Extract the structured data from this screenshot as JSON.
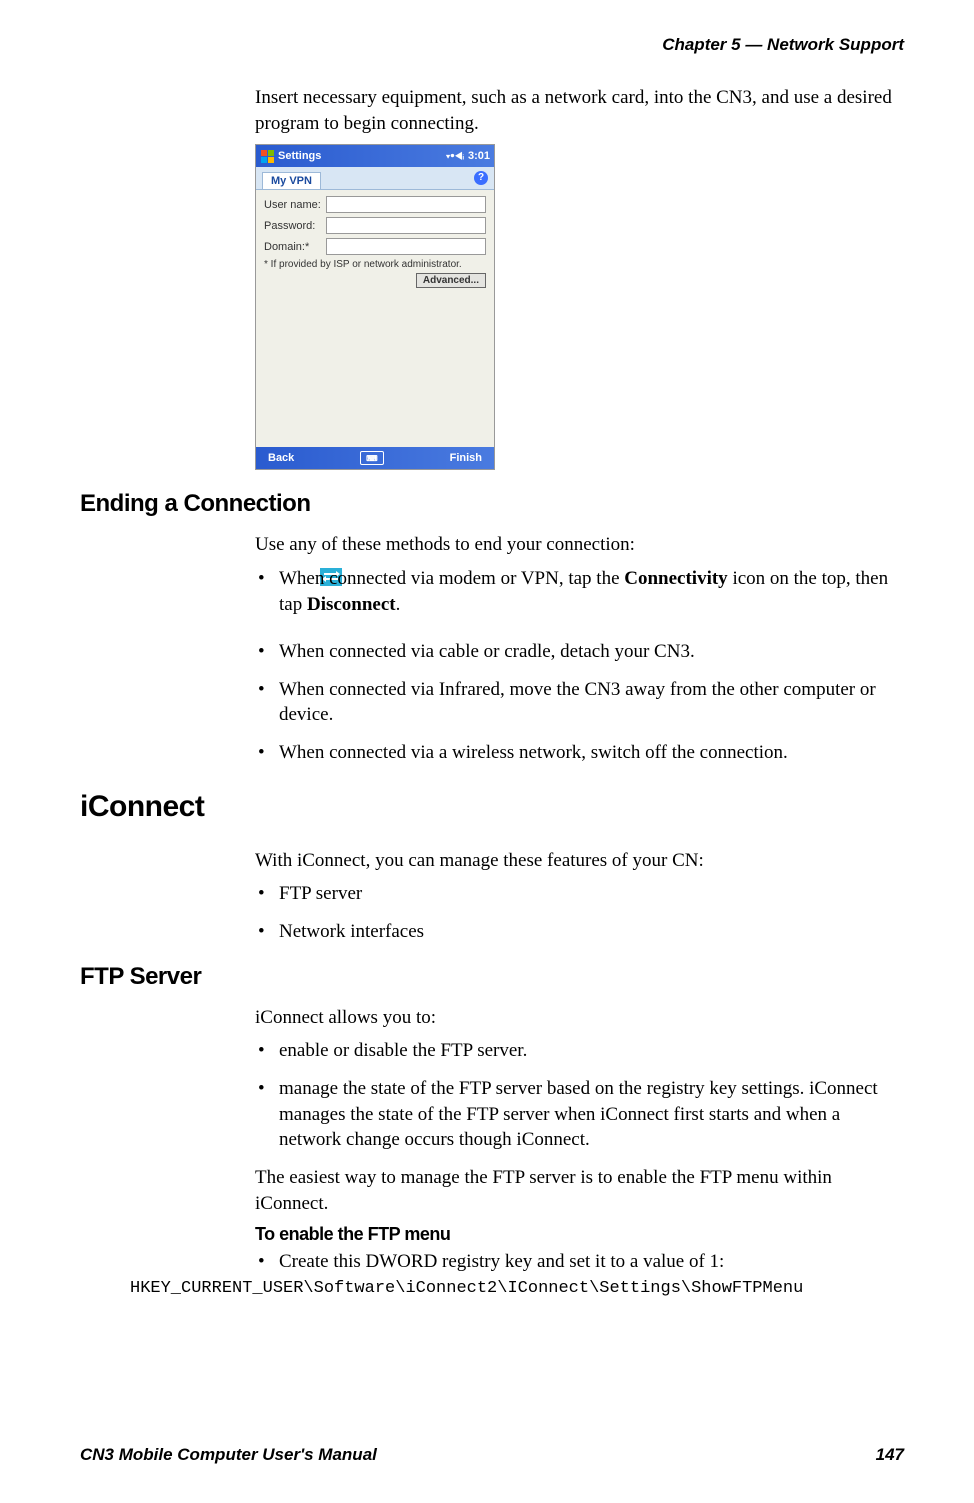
{
  "header": {
    "chapter": "Chapter 5 —  Network Support"
  },
  "intro_text": "Insert necessary equipment, such as a network card, into the CN3, and use a desired program to begin connecting.",
  "screenshot": {
    "titlebar": {
      "title": "Settings",
      "time": "3:01"
    },
    "tab": "My VPN",
    "fields": {
      "username_label": "User name:",
      "password_label": "Password:",
      "domain_label": "Domain:*"
    },
    "note": "* If provided by ISP or network administrator.",
    "advanced_btn": "Advanced...",
    "back_btn": "Back",
    "finish_btn": "Finish"
  },
  "ending": {
    "heading": "Ending a Connection",
    "intro": "Use any of these methods to end your connection:",
    "item1_pre": "When connected via modem or VPN, tap the ",
    "item1_bold1": "Connectivity",
    "item1_mid": " icon on the top, then tap ",
    "item1_bold2": "Disconnect",
    "item1_post": ".",
    "item2": "When connected via cable or cradle, detach your CN3.",
    "item3": "When connected via Infrared, move the CN3 away from the other computer or device.",
    "item4": "When connected via a wireless network, switch off the connection."
  },
  "iconnect": {
    "heading": "iConnect",
    "intro": "With iConnect, you can manage these features of your CN:",
    "item1": "FTP server",
    "item2": "Network interfaces"
  },
  "ftp": {
    "heading": "FTP Server",
    "intro": "iConnect allows you to:",
    "item1": "enable or disable the FTP server.",
    "item2": "manage the state of the FTP server based on the registry key settings. iConnect manages the state of the FTP server when iConnect first starts and when a network change occurs though iConnect.",
    "outro": "The easiest way to manage the FTP server is to enable the FTP menu within iConnect.",
    "subheading": "To enable the FTP menu",
    "sub_item": "Create this DWORD registry key and set it to a value of 1:",
    "regkey": "HKEY_CURRENT_USER\\Software\\iConnect2\\IConnect\\Settings\\ShowFTPMenu"
  },
  "footer": {
    "manual": "CN3 Mobile Computer User's Manual",
    "page": "147"
  }
}
